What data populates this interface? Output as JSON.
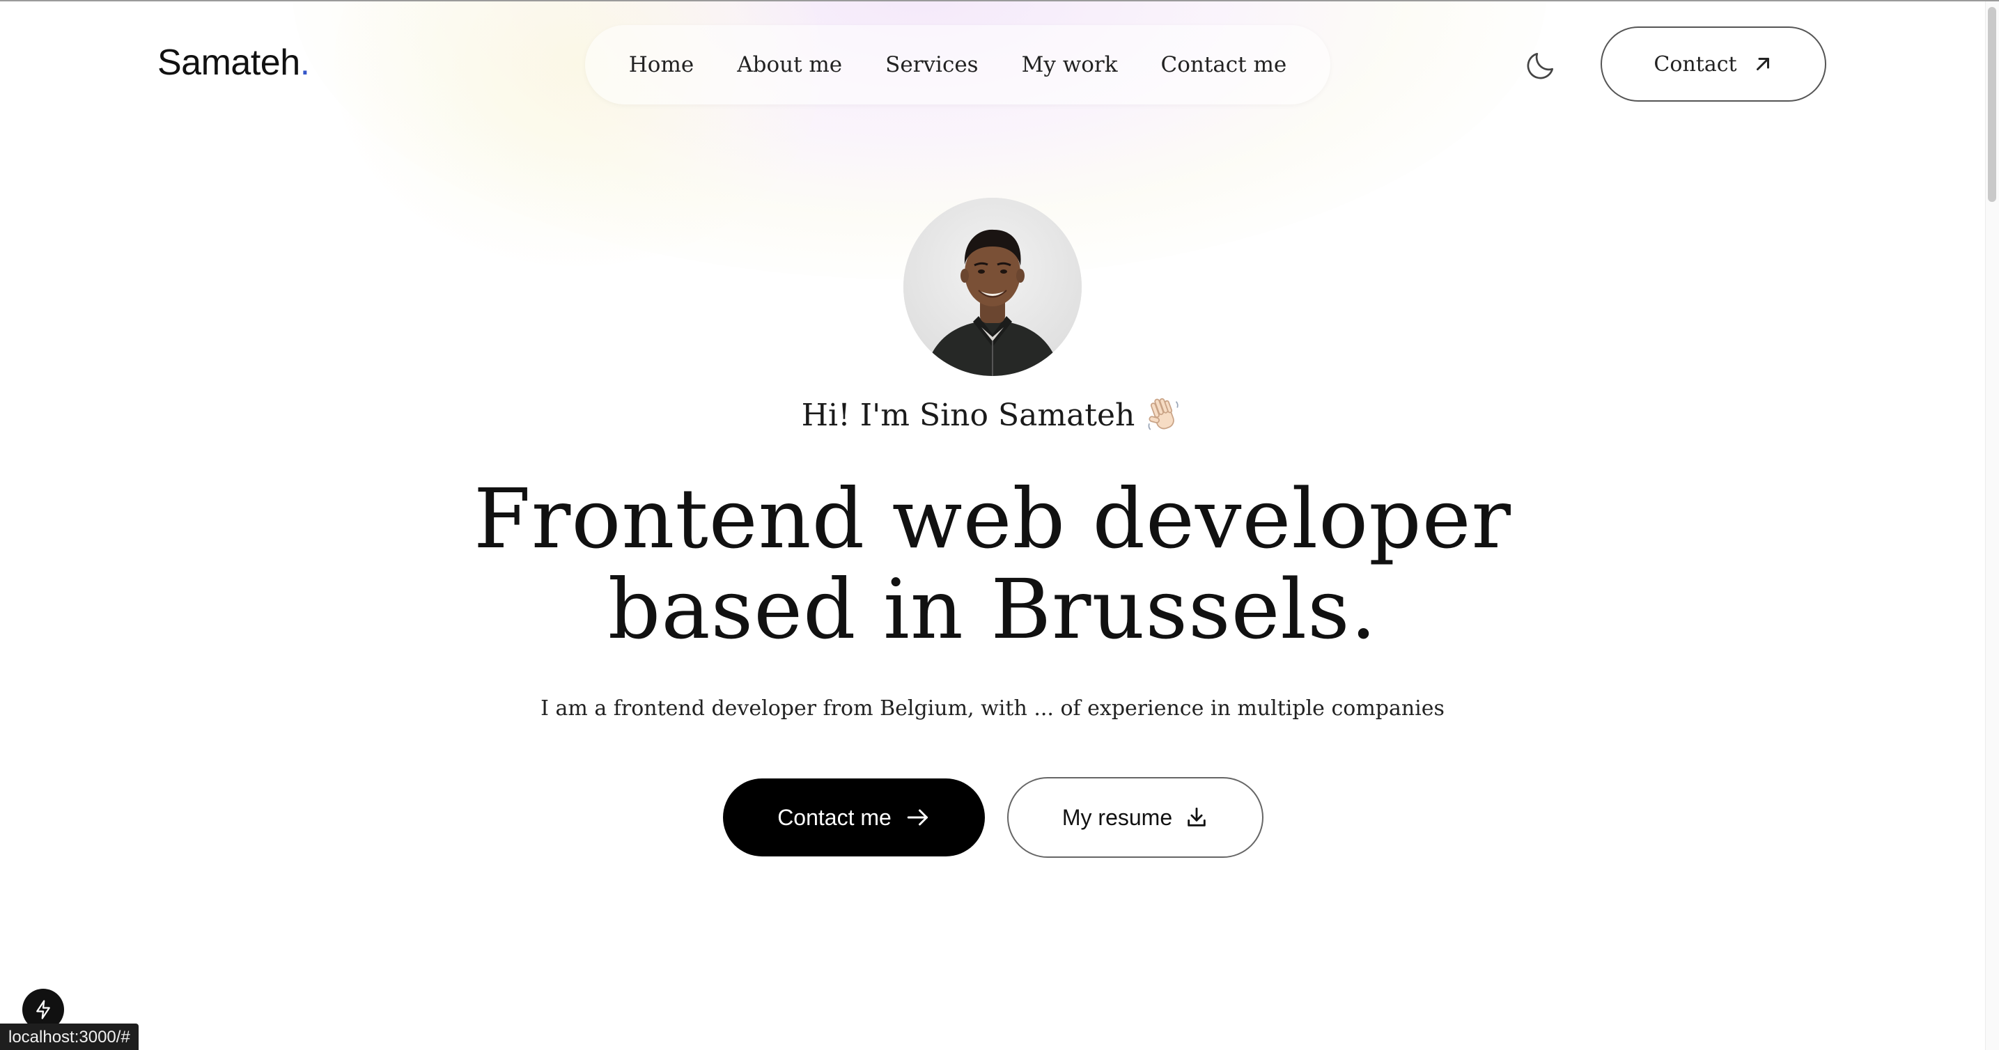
{
  "header": {
    "logo_text": "Samateh",
    "logo_dot": ".",
    "logo_dot_color": "#3557c9",
    "nav_items": [
      {
        "label": "Home"
      },
      {
        "label": "About me"
      },
      {
        "label": "Services"
      },
      {
        "label": "My work"
      },
      {
        "label": "Contact me"
      }
    ],
    "theme_toggle_icon": "moon-icon",
    "contact_button_label": "Contact",
    "contact_button_icon": "arrow-up-right-icon"
  },
  "hero": {
    "avatar_alt": "profile-photo",
    "greeting": "Hi! I'm Sino Samateh",
    "greeting_icon": "waving-hand-icon",
    "headline_line1": "Frontend web developer",
    "headline_line2": "based in Brussels.",
    "subtext": "I am a frontend developer from Belgium, with ... of experience in multiple companies",
    "primary_cta_label": "Contact me",
    "primary_cta_icon": "arrow-right-icon",
    "secondary_cta_label": "My resume",
    "secondary_cta_icon": "download-icon"
  },
  "browser": {
    "status_url": "localhost:3000/#",
    "devtools_icon": "lightning-icon"
  },
  "colors": {
    "accent": "#3557c9",
    "primary_button_bg": "#000000",
    "text": "#111111"
  }
}
